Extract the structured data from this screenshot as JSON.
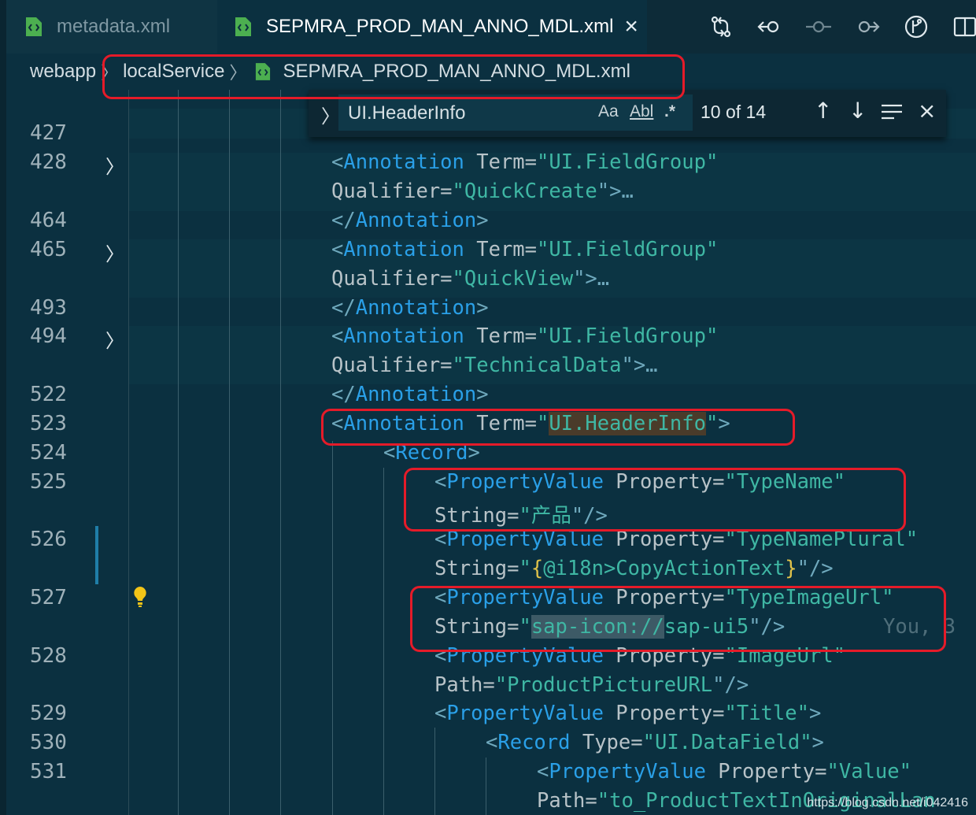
{
  "tabs": [
    {
      "label": "metadata.xml",
      "active": false
    },
    {
      "label": "SEPMRA_PROD_MAN_ANNO_MDL.xml",
      "active": true
    }
  ],
  "tab_close_glyph": "×",
  "toolbar_icons": [
    "compare-changes-icon",
    "go-back-icon",
    "commit-icon",
    "go-forward-icon",
    "git-graph-icon",
    "split-editor-icon"
  ],
  "breadcrumb": [
    "webapp",
    "localService",
    "SEPMRA_PROD_MAN_ANNO_MDL.xml"
  ],
  "find": {
    "query": "UI.HeaderInfo",
    "match_case": "Aa",
    "whole_word": "Abl",
    "regex": ".*",
    "count": "10 of 14"
  },
  "line_numbers": {
    "l427": "427",
    "l428": "428",
    "l464": "464",
    "l465": "465",
    "l493": "493",
    "l494": "494",
    "l522": "522",
    "l523": "523",
    "l524": "524",
    "l525": "525",
    "l526": "526",
    "l527": "527",
    "l528": "528",
    "l529": "529",
    "l530": "530",
    "l531": "531"
  },
  "code": {
    "lt": "<",
    "gt": ">",
    "end_lt": "</",
    "self_close": "\"/>",
    "quote": "\"",
    "ellipsis": "\">…",
    "Annotation": "Annotation",
    "Term": " Term=",
    "Qualifier": "Qualifier=",
    "fieldgroup": "\"UI.FieldGroup\"",
    "quickcreate": "\"QuickCreate",
    "quickview": "\"QuickView",
    "technicaldata": "\"TechnicalData",
    "headerinfo": "UI.HeaderInfo",
    "Record": "Record",
    "PropertyValue": "PropertyValue",
    "Property": " Property=",
    "String": "String=",
    "Path": "Path=",
    "Type": " Type=",
    "typename": "\"TypeName\"",
    "typename_val": "\"产品",
    "typenameplural": "\"TypeNamePlural\"",
    "brace_open": "{",
    "i18n": "@i18n>CopyActionText",
    "brace_close": "}",
    "typeimageurl": "\"TypeImageUrl\"",
    "sapicon_sel": "sap-icon://",
    "sapicon_rest": "sap-ui5",
    "imageurl": "\"ImageUrl\"",
    "pictureurl": "\"ProductPictureURL",
    "title": "\"Title\"",
    "datafield": "\"UI.DataField\"",
    "value": "\"Value\"",
    "to_product": "\"to_ProductTextInOriginalLan",
    "blame": "You, 3"
  },
  "watermark": "https://blog.csdn.net/i042416",
  "colors": {
    "highlight_box": "#e51b29",
    "element": "#2aa0e8",
    "string": "#3fb7a4"
  }
}
